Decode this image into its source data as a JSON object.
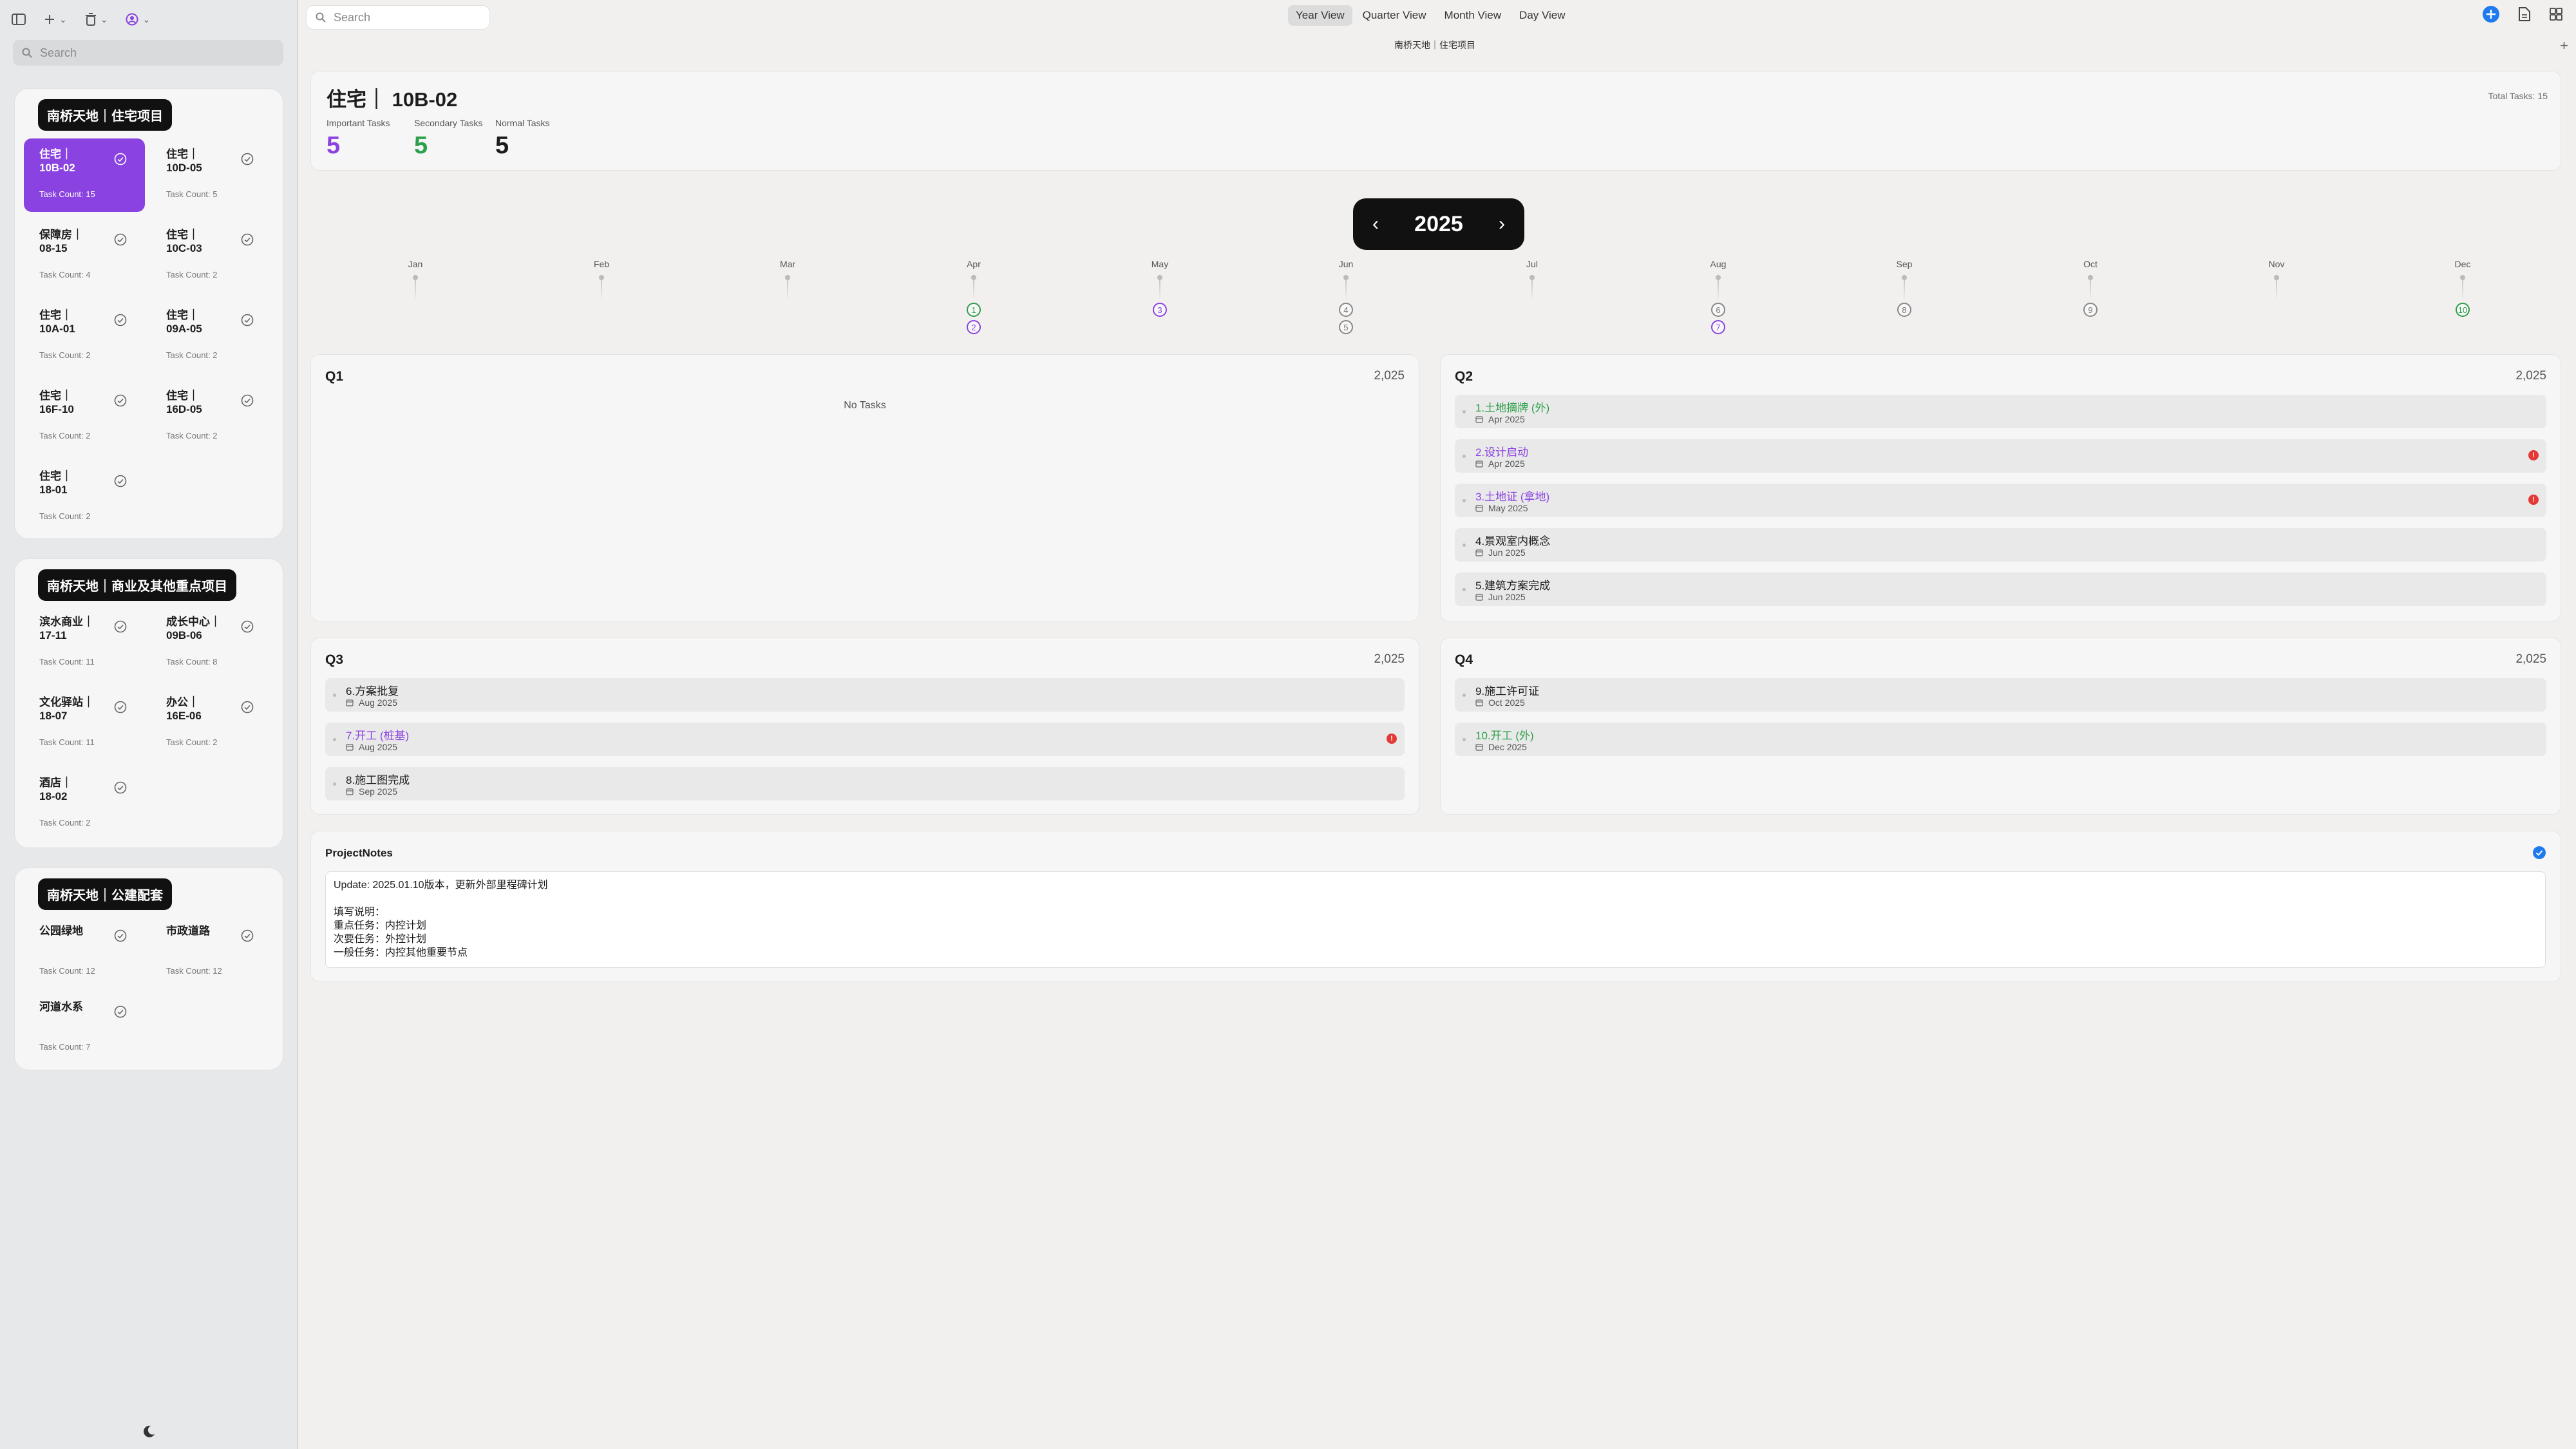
{
  "sidebar": {
    "search_placeholder": "Search",
    "groups": [
      {
        "title": "南桥天地｜住宅项目",
        "cards": [
          {
            "name": "住宅｜\n10B-02",
            "count": "Task Count: 15",
            "active": true
          },
          {
            "name": "住宅｜\n10D-05",
            "count": "Task Count: 5"
          },
          {
            "name": "保障房｜\n08-15",
            "count": "Task Count: 4"
          },
          {
            "name": "住宅｜\n10C-03",
            "count": "Task Count: 2"
          },
          {
            "name": "住宅｜\n10A-01",
            "count": "Task Count: 2"
          },
          {
            "name": "住宅｜\n09A-05",
            "count": "Task Count: 2"
          },
          {
            "name": "住宅｜\n16F-10",
            "count": "Task Count: 2"
          },
          {
            "name": "住宅｜\n16D-05",
            "count": "Task Count: 2"
          },
          {
            "name": "住宅｜\n18-01",
            "count": "Task Count: 2"
          }
        ]
      },
      {
        "title": "南桥天地｜商业及其他重点项目",
        "cards": [
          {
            "name": "滨水商业｜\n17-11",
            "count": "Task Count: 11"
          },
          {
            "name": "成长中心｜\n09B-06",
            "count": "Task Count: 8"
          },
          {
            "name": "文化驿站｜\n18-07",
            "count": "Task Count: 11"
          },
          {
            "name": "办公｜\n16E-06",
            "count": "Task Count: 2"
          },
          {
            "name": "酒店｜\n18-02",
            "count": "Task Count: 2"
          }
        ]
      },
      {
        "title": "南桥天地｜公建配套",
        "cards": [
          {
            "name": "公园绿地",
            "count": "Task Count: 12"
          },
          {
            "name": "市政道路",
            "count": "Task Count: 12"
          },
          {
            "name": "河道水系",
            "count": "Task Count: 7"
          }
        ]
      }
    ]
  },
  "toolbar": {
    "search_placeholder": "Search",
    "views": [
      "Year View",
      "Quarter View",
      "Month View",
      "Day View"
    ],
    "active_view": "Year View",
    "breadcrumb": "南桥天地｜住宅项目"
  },
  "header": {
    "title": "住宅｜ 10B-02",
    "total": "Total Tasks: 15",
    "stats": [
      {
        "label": "Important Tasks",
        "value": "5",
        "color": "#8a43e0"
      },
      {
        "label": "Secondary Tasks",
        "value": "5",
        "color": "#2e9f4a"
      },
      {
        "label": "Normal Tasks",
        "value": "5",
        "color": "#1d1d1f"
      }
    ]
  },
  "year": "2025",
  "timeline": {
    "months": [
      "Jan",
      "Feb",
      "Mar",
      "Apr",
      "May",
      "Jun",
      "Jul",
      "Aug",
      "Sep",
      "Oct",
      "Nov",
      "Dec"
    ],
    "markers": [
      {
        "month": 3,
        "row": 0,
        "label": "1",
        "color": "green"
      },
      {
        "month": 3,
        "row": 1,
        "label": "2",
        "color": "purple"
      },
      {
        "month": 4,
        "row": 0,
        "label": "3",
        "color": "purple"
      },
      {
        "month": 5,
        "row": 0,
        "label": "4",
        "color": "gray"
      },
      {
        "month": 5,
        "row": 1,
        "label": "5",
        "color": "gray"
      },
      {
        "month": 7,
        "row": 0,
        "label": "6",
        "color": "gray"
      },
      {
        "month": 7,
        "row": 1,
        "label": "7",
        "color": "purple"
      },
      {
        "month": 8,
        "row": 0,
        "label": "8",
        "color": "gray"
      },
      {
        "month": 9,
        "row": 0,
        "label": "9",
        "color": "gray"
      },
      {
        "month": 11,
        "row": 0,
        "label": "10",
        "color": "green"
      }
    ]
  },
  "quarters": {
    "q1": {
      "label": "Q1",
      "year": "2,025",
      "empty": "No Tasks",
      "tasks": []
    },
    "q2": {
      "label": "Q2",
      "year": "2,025",
      "tasks": [
        {
          "name": "1.土地摘牌 (外)",
          "date": "Apr 2025",
          "color": "green",
          "alert": false
        },
        {
          "name": "2.设计启动",
          "date": "Apr 2025",
          "color": "purple",
          "alert": true
        },
        {
          "name": "3.土地证 (拿地)",
          "date": "May 2025",
          "color": "purple",
          "alert": true
        },
        {
          "name": "4.景观室内概念",
          "date": "Jun 2025",
          "color": "black",
          "alert": false
        },
        {
          "name": "5.建筑方案完成",
          "date": "Jun 2025",
          "color": "black",
          "alert": false
        }
      ]
    },
    "q3": {
      "label": "Q3",
      "year": "2,025",
      "tasks": [
        {
          "name": "6.方案批复",
          "date": "Aug 2025",
          "color": "black",
          "alert": false
        },
        {
          "name": "7.开工 (桩基)",
          "date": "Aug 2025",
          "color": "purple",
          "alert": true
        },
        {
          "name": "8.施工图完成",
          "date": "Sep 2025",
          "color": "black",
          "alert": false
        }
      ]
    },
    "q4": {
      "label": "Q4",
      "year": "2,025",
      "tasks": [
        {
          "name": "9.施工许可证",
          "date": "Oct 2025",
          "color": "black",
          "alert": false
        },
        {
          "name": "10.开工 (外)",
          "date": "Dec 2025",
          "color": "green",
          "alert": false
        }
      ]
    }
  },
  "notes": {
    "title": "ProjectNotes",
    "body": "Update: 2025.01.10版本，更新外部里程碑计划\n\n填写说明：\n重点任务：内控计划\n次要任务：外控计划\n一般任务：内控其他重要节点"
  }
}
